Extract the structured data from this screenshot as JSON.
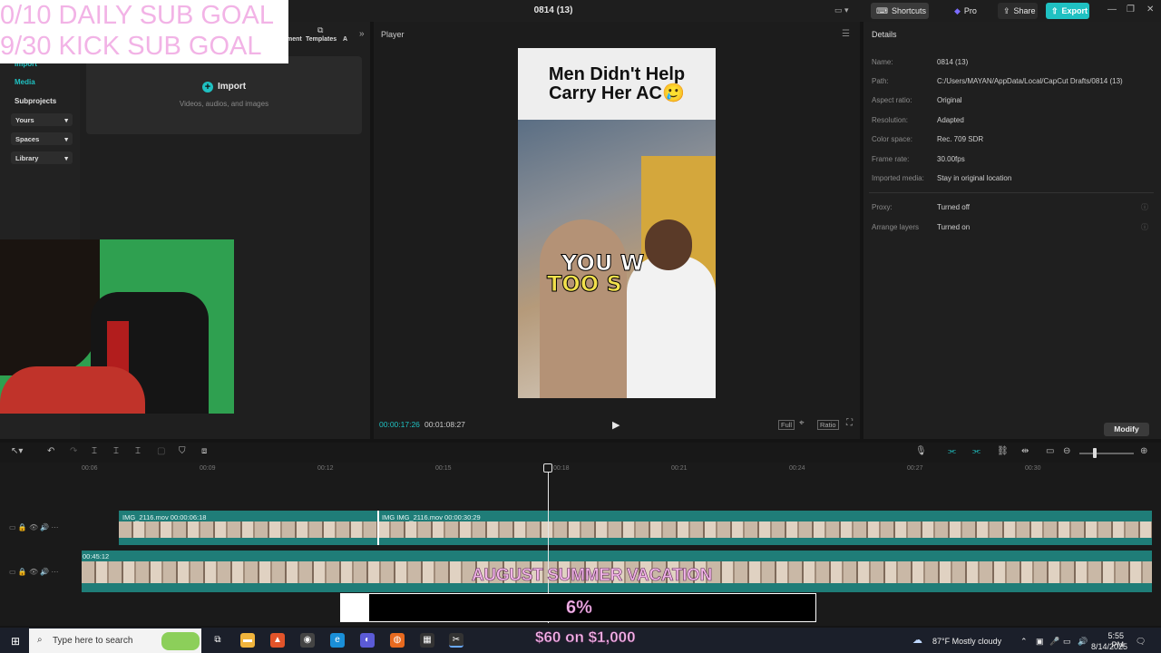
{
  "window": {
    "project_name": "0814 (13)",
    "shortcuts_label": "Shortcuts",
    "pro_label": "Pro",
    "share_label": "Share",
    "export_label": "Export"
  },
  "overlay": {
    "daily_goal": "0/10 DAILY SUB GOAL",
    "kick_goal": "9/30 KICK SUB GOAL",
    "banner": "AUGUST SUMMER VACATION",
    "progress_text": "6%",
    "progress_fraction": 0.06,
    "goal_amount": "$60 on $1,000"
  },
  "left_nav": {
    "items": [
      "Import",
      "Media",
      "Subprojects"
    ],
    "dropdowns": [
      "Yours",
      "Spaces",
      "Library"
    ],
    "tabs": [
      "ment",
      "Templates",
      "A"
    ]
  },
  "media": {
    "import_label": "Import",
    "import_hint": "Videos, audios, and images"
  },
  "player": {
    "title": "Player",
    "headline_line1": "Men Didn't Help",
    "headline_line2": "Carry Her AC🥲",
    "caption_line1": "YOU W",
    "caption_line2": "TOO S",
    "current_time": "00:00:17:26",
    "total_time": "00:01:08:27",
    "controls": [
      "Full",
      "Ratio"
    ]
  },
  "details": {
    "title": "Details",
    "rows": [
      {
        "label": "Name:",
        "value": "0814 (13)"
      },
      {
        "label": "Path:",
        "value": "C:/Users/MAYAN/AppData/Local/CapCut Drafts/0814 (13)"
      },
      {
        "label": "Aspect ratio:",
        "value": "Original"
      },
      {
        "label": "Resolution:",
        "value": "Adapted"
      },
      {
        "label": "Color space:",
        "value": "Rec. 709 SDR"
      },
      {
        "label": "Frame rate:",
        "value": "30.00fps"
      },
      {
        "label": "Imported media:",
        "value": "Stay in original location"
      },
      {
        "label": "Proxy:",
        "value": "Turned off"
      },
      {
        "label": "Arrange layers",
        "value": "Turned on"
      }
    ],
    "modify_label": "Modify"
  },
  "timeline": {
    "ruler": [
      "00:06",
      "00:09",
      "00:12",
      "00:15",
      "00:18",
      "00:21",
      "00:24",
      "00:27",
      "00:30"
    ],
    "clip1_label": "IMG_2116.mov   00:00:06:18",
    "clip1b_label": "IMG   IMG_2116.mov   00:00:30:29",
    "clip2_time": "00:45:12"
  },
  "taskbar": {
    "search_placeholder": "Type here to search",
    "weather": "87°F  Mostly cloudy",
    "time": "5:55 PM",
    "date": "8/14/2025"
  }
}
